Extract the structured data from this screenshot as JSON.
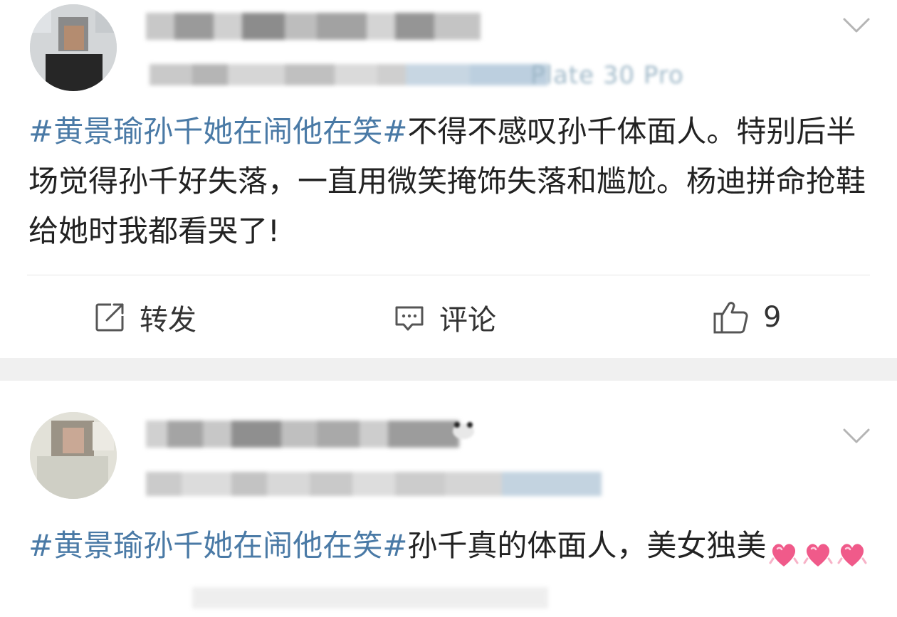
{
  "posts": [
    {
      "device_partial": "Plate 30 Pro",
      "text_hashtag": "#黄景瑜孙千她在闹他在笑#",
      "text_body": "不得不感叹孙千体面人。特别后半场觉得孙千好失落，一直用微笑掩饰失落和尴尬。杨迪拼命抢鞋给她时我都看哭了!",
      "actions": {
        "repost_label": "转发",
        "comment_label": "评论",
        "like_count": "9"
      }
    },
    {
      "text_hashtag": "#黄景瑜孙千她在闹他在笑#",
      "text_body": "孙千真的体面人，美女独美"
    }
  ],
  "colors": {
    "hashtag": "#4a7aa6",
    "text": "#222222",
    "separator": "#f0f0f0",
    "icon": "#555555"
  },
  "icons": [
    "chevron-down-icon",
    "repost-icon",
    "comment-icon",
    "like-icon",
    "heart-emoji-icon"
  ]
}
